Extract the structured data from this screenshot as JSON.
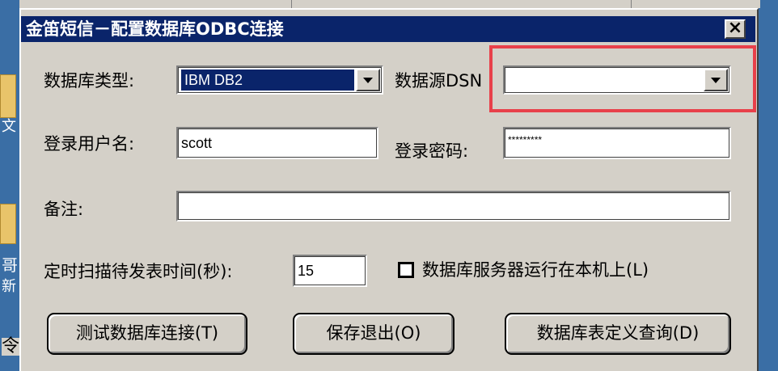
{
  "window": {
    "title": "金笛短信－配置数据库ODBC连接",
    "close_label": "×"
  },
  "desktop": {
    "left_glyphs": [
      "文",
      "哥",
      "新",
      "令"
    ]
  },
  "form": {
    "db_type_label": "数据库类型:",
    "db_type_value": "IBM DB2",
    "dsn_label": "数据源DSN",
    "dsn_value": "",
    "username_label": "登录用户名:",
    "username_value": "scott",
    "password_label": "登录密码:",
    "password_value": "*********",
    "remark_label": "备注:",
    "remark_value": "",
    "scan_label": "定时扫描待发表时间(秒):",
    "scan_value": "15",
    "local_server_label": "数据库服务器运行在本机上(L)",
    "local_server_checked": false
  },
  "buttons": {
    "test": "测试数据库连接(T)",
    "save": "保存退出(O)",
    "query": "数据库表定义查询(D)"
  },
  "colors": {
    "titlebar": "#0a246a",
    "desktop": "#3a6ea5",
    "highlight": "#e8404a",
    "face": "#d4d0c8"
  }
}
